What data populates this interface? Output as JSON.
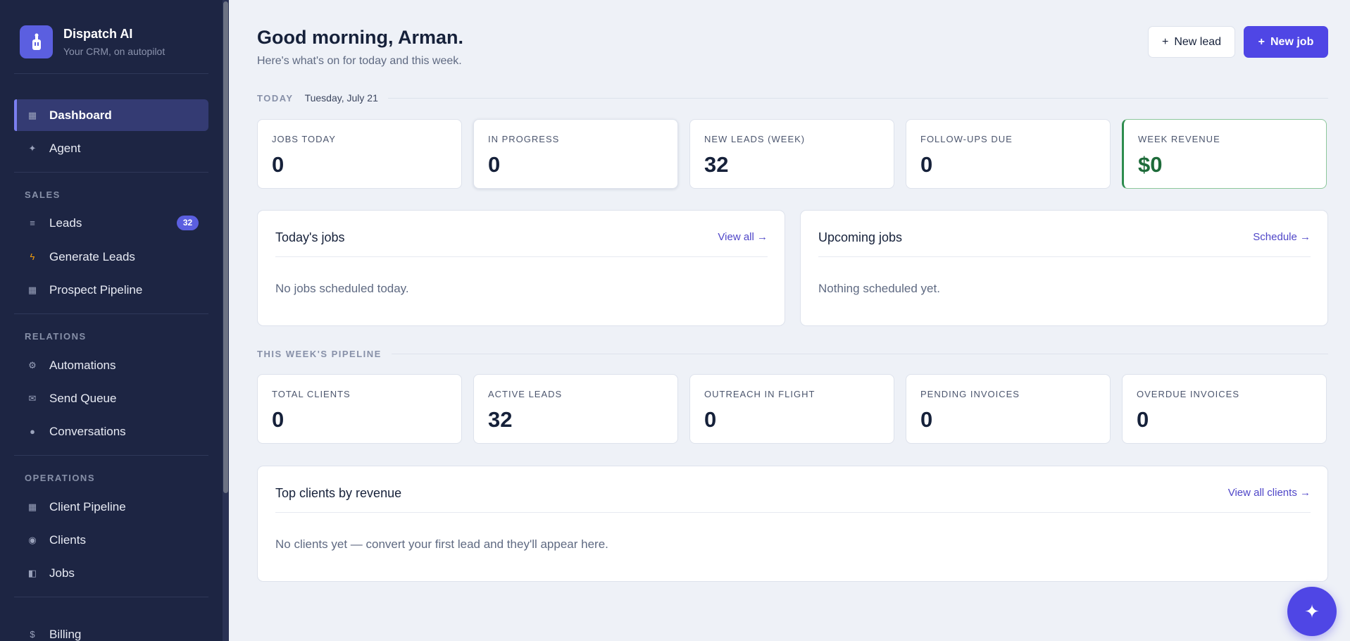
{
  "sidebar": {
    "brand_name": "Dispatch AI",
    "brand_tagline": "Your CRM, on autopilot",
    "sections": {
      "sales": "SALES",
      "relations": "RELATIONS",
      "operations": "OPERATIONS"
    },
    "items": {
      "dashboard": "Dashboard",
      "agent": "Agent",
      "leads": "Leads",
      "leads_badge": "32",
      "generate_leads": "Generate Leads",
      "prospect_pipeline": "Prospect Pipeline",
      "automations": "Automations",
      "send_queue": "Send Queue",
      "conversations": "Conversations",
      "client_pipeline": "Client Pipeline",
      "clients": "Clients",
      "jobs": "Jobs",
      "billing": "Billing"
    }
  },
  "header": {
    "greeting": "Good morning, Arman.",
    "subtitle": "Here's what's on for today and this week.",
    "new_lead": "New lead",
    "new_job": "New job"
  },
  "today": {
    "label": "TODAY",
    "date": "Tuesday, July 21",
    "stats": [
      {
        "label": "JOBS TODAY",
        "value": "0"
      },
      {
        "label": "IN PROGRESS",
        "value": "0"
      },
      {
        "label": "NEW LEADS (WEEK)",
        "value": "32"
      },
      {
        "label": "FOLLOW-UPS DUE",
        "value": "0"
      },
      {
        "label": "WEEK REVENUE",
        "value": "$0"
      }
    ]
  },
  "todays_jobs": {
    "title": "Today's jobs",
    "link": "View all →",
    "empty": "No jobs scheduled today."
  },
  "upcoming_jobs": {
    "title": "Upcoming jobs",
    "link": "Schedule →",
    "empty": "Nothing scheduled yet."
  },
  "pipeline": {
    "label": "THIS WEEK'S PIPELINE",
    "stats": [
      {
        "label": "TOTAL CLIENTS",
        "value": "0"
      },
      {
        "label": "ACTIVE LEADS",
        "value": "32"
      },
      {
        "label": "OUTREACH IN FLIGHT",
        "value": "0"
      },
      {
        "label": "PENDING INVOICES",
        "value": "0"
      },
      {
        "label": "OVERDUE INVOICES",
        "value": "0"
      }
    ]
  },
  "top_clients": {
    "title": "Top clients by revenue",
    "link": "View all clients →",
    "empty": "No clients yet — convert your first lead and they'll appear here."
  },
  "colors": {
    "sidebar_bg": "#1d2543",
    "accent": "#4f46e5",
    "revenue_green": "#1e6b3a"
  },
  "icons": {
    "brand": "robot-icon",
    "fab": "sparkle-icon"
  }
}
